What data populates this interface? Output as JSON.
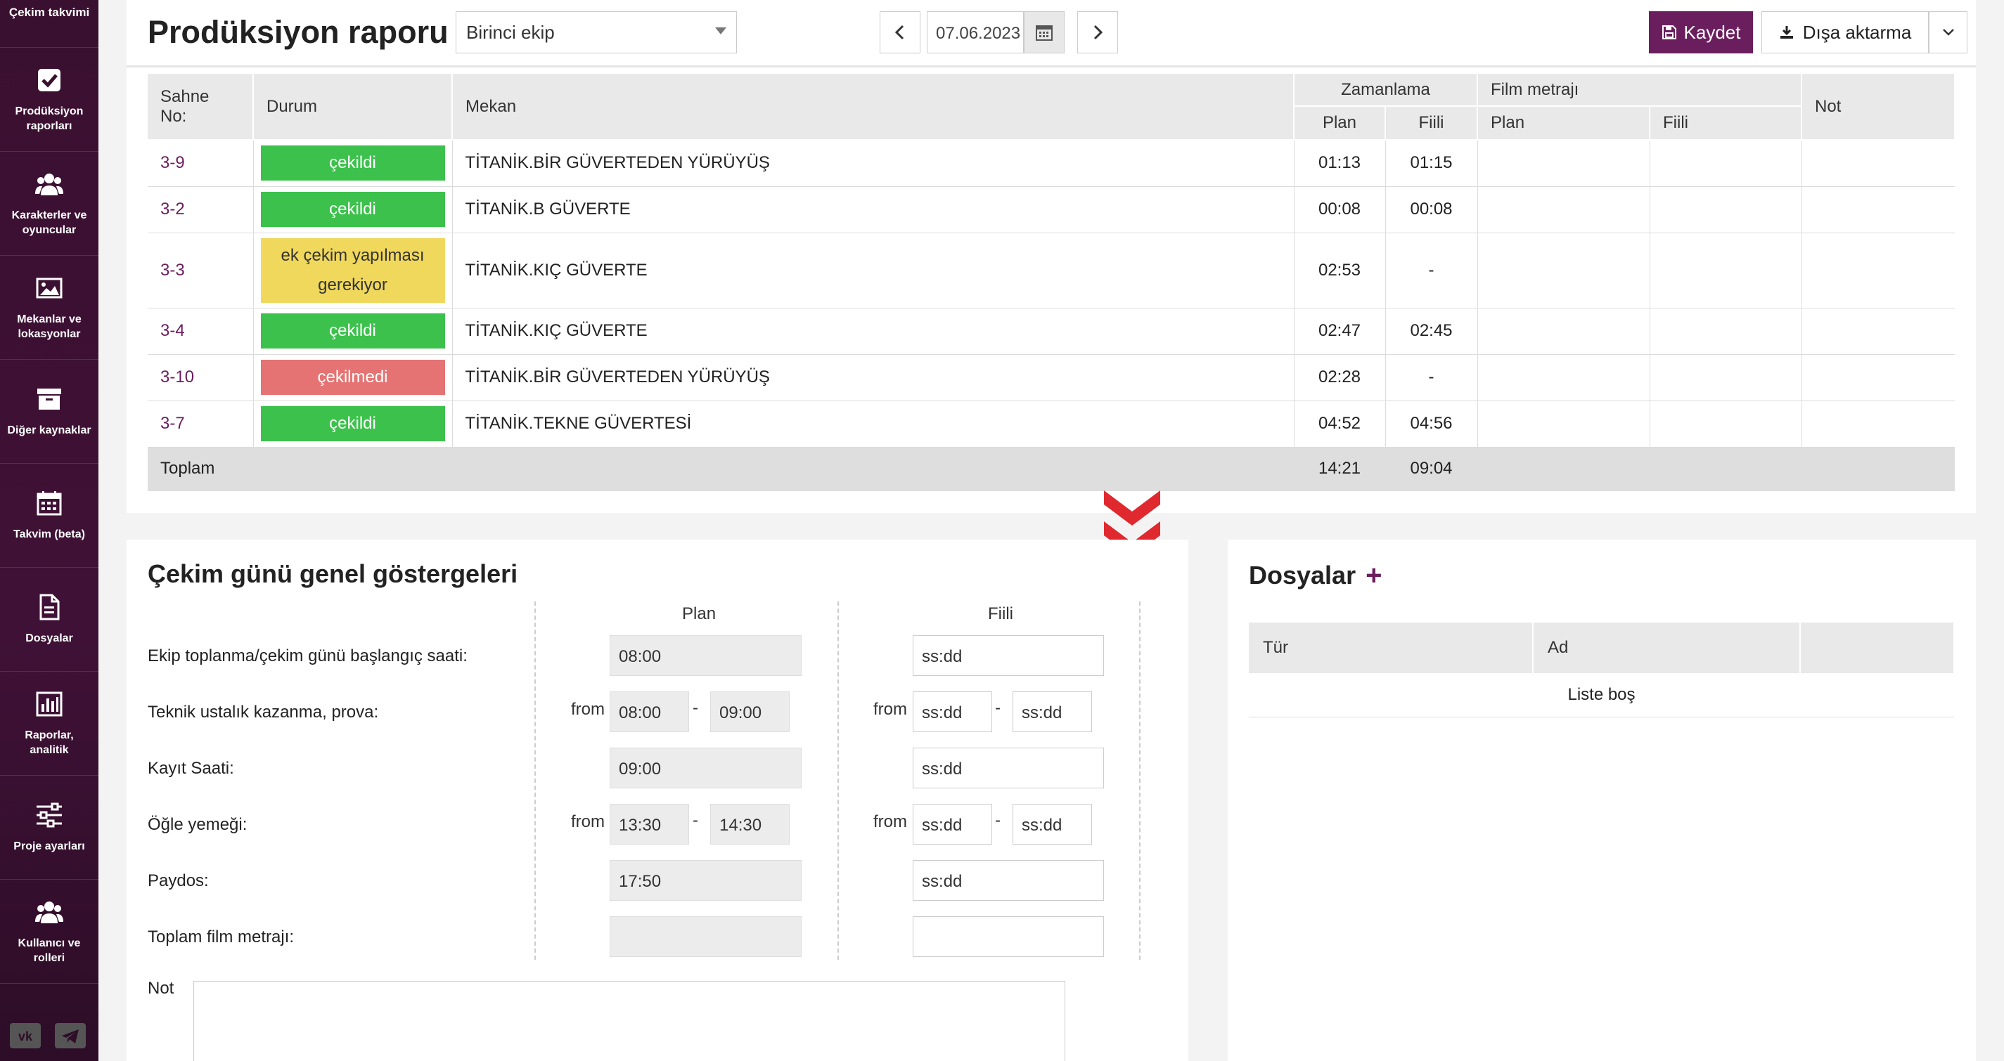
{
  "sidebar": {
    "top": "Çekim takvimi",
    "items": [
      {
        "label": "Prodüksiyon raporları",
        "icon": "checkbox-icon"
      },
      {
        "label": "Karakterler ve oyuncular",
        "icon": "users-icon"
      },
      {
        "label": "Mekanlar ve lokasyonlar",
        "icon": "image-icon"
      },
      {
        "label": "Diğer kaynaklar",
        "icon": "archive-icon"
      },
      {
        "label": "Takvim (beta)",
        "icon": "calendar-icon"
      },
      {
        "label": "Dosyalar",
        "icon": "file-icon"
      },
      {
        "label": "Raporlar, analitik",
        "icon": "chart-icon"
      },
      {
        "label": "Proje ayarları",
        "icon": "sliders-icon"
      },
      {
        "label": "Kullanıcı ve rolleri",
        "icon": "users-icon"
      }
    ],
    "social": [
      "vk-icon",
      "telegram-icon"
    ]
  },
  "header": {
    "title": "Prodüksiyon raporu",
    "crew_select": "Birinci ekip",
    "date": "07.06.2023",
    "save_label": "Kaydet",
    "export_label": "Dışa aktarma"
  },
  "scenes": {
    "headers": {
      "scene": "Sahne No:",
      "status": "Durum",
      "location": "Mekan",
      "timing": "Zamanlama",
      "footage": "Film metrajı",
      "note": "Not",
      "plan": "Plan",
      "actual": "Fiili"
    },
    "rows": [
      {
        "scene": "3-9",
        "status": "çekildi",
        "status_color": "#3cc24c",
        "location": "TİTANİK.BİR GÜVERTEDEN YÜRÜYÜŞ",
        "plan": "01:13",
        "actual": "01:15"
      },
      {
        "scene": "3-2",
        "status": "çekildi",
        "status_color": "#3cc24c",
        "location": "TİTANİK.B GÜVERTE",
        "plan": "00:08",
        "actual": "00:08"
      },
      {
        "scene": "3-3",
        "status": "ek çekim yapılması gerekiyor",
        "status_color": "#f0d85c",
        "location": "TİTANİK.KIÇ GÜVERTE",
        "plan": "02:53",
        "actual": "-"
      },
      {
        "scene": "3-4",
        "status": "çekildi",
        "status_color": "#3cc24c",
        "location": "TİTANİK.KIÇ GÜVERTE",
        "plan": "02:47",
        "actual": "02:45"
      },
      {
        "scene": "3-10",
        "status": "çekilmedi",
        "status_color": "#e57373",
        "location": "TİTANİK.BİR GÜVERTEDEN YÜRÜYÜŞ",
        "plan": "02:28",
        "actual": "-"
      },
      {
        "scene": "3-7",
        "status": "çekildi",
        "status_color": "#3cc24c",
        "location": "TİTANİK.TEKNE GÜVERTESİ",
        "plan": "04:52",
        "actual": "04:56"
      }
    ],
    "total": {
      "label": "Toplam",
      "plan": "14:21",
      "actual": "09:04"
    }
  },
  "indicators": {
    "title": "Çekim günü genel göstergeleri",
    "plan_header": "Plan",
    "actual_header": "Fiili",
    "from": "from",
    "dash": "-",
    "rows": [
      {
        "label": "Ekip toplanma/çekim günü başlangıç saati:",
        "plan": "08:00",
        "actual": "ss:dd"
      },
      {
        "label": "Teknik ustalık kazanma, prova:",
        "plan_from": "08:00",
        "plan_to": "09:00",
        "actual_from": "ss:dd",
        "actual_to": "ss:dd"
      },
      {
        "label": "Kayıt Saati:",
        "plan": "09:00",
        "actual": "ss:dd"
      },
      {
        "label": "Öğle yemeği:",
        "plan_from": "13:30",
        "plan_to": "14:30",
        "actual_from": "ss:dd",
        "actual_to": "ss:dd"
      },
      {
        "label": "Paydos:",
        "plan": "17:50",
        "actual": "ss:dd"
      },
      {
        "label": "Toplam film metrajı:",
        "plan": "",
        "actual": ""
      }
    ],
    "note_label": "Not"
  },
  "files": {
    "title": "Dosyalar",
    "add": "+",
    "headers": [
      "Tür",
      "Ad",
      ""
    ],
    "empty": "Liste boş"
  },
  "colors": {
    "accent": "#6b1e5e",
    "sidebar": "#3a1030"
  }
}
